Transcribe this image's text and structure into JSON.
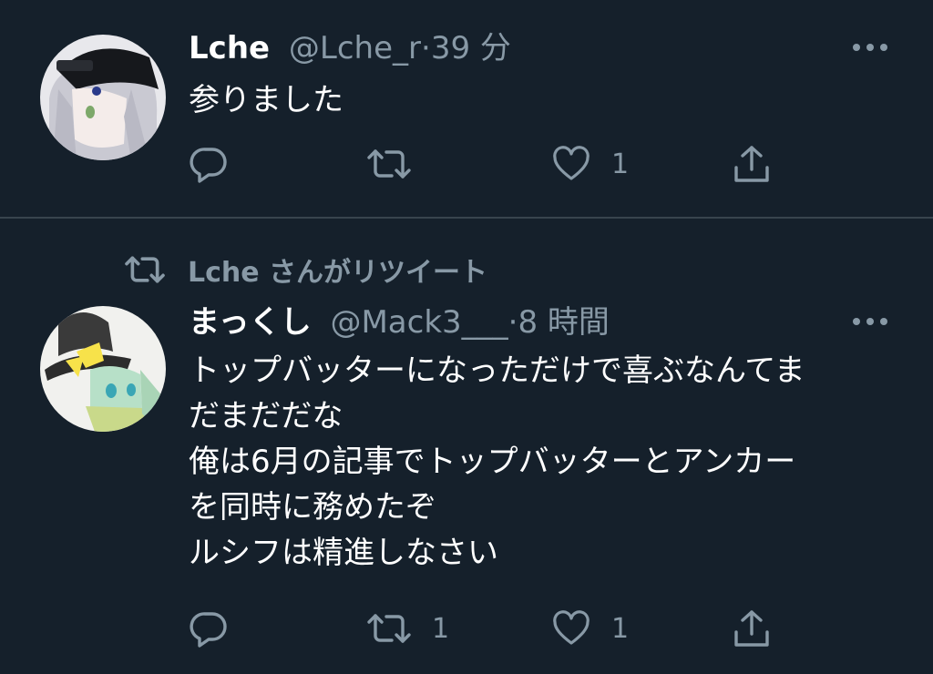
{
  "tweets": [
    {
      "display_name": "Lche",
      "handle": "@Lche_r",
      "separator": "·",
      "time": "39 分",
      "text": "参りました",
      "reply_count": "",
      "retweet_count": "",
      "like_count": "1"
    },
    {
      "retweeted_by_label": "Lche さんがリツイート",
      "display_name": "まっくし",
      "handle": "@Mack3___",
      "separator": "·",
      "time": "8 時間",
      "text": "トップバッターになっただけで喜ぶなんてま\nだまだだな\n俺は6月の記事でトップバッターとアンカー\nを同時に務めたぞ\nルシフは精進しなさい",
      "reply_count": "",
      "retweet_count": "1",
      "like_count": "1"
    }
  ],
  "colors": {
    "background": "#15202b",
    "divider": "#38444d",
    "text_primary": "#ffffff",
    "text_secondary": "#8899a6"
  },
  "icons": [
    "reply-icon",
    "retweet-icon",
    "like-icon",
    "share-icon",
    "more-icon"
  ]
}
